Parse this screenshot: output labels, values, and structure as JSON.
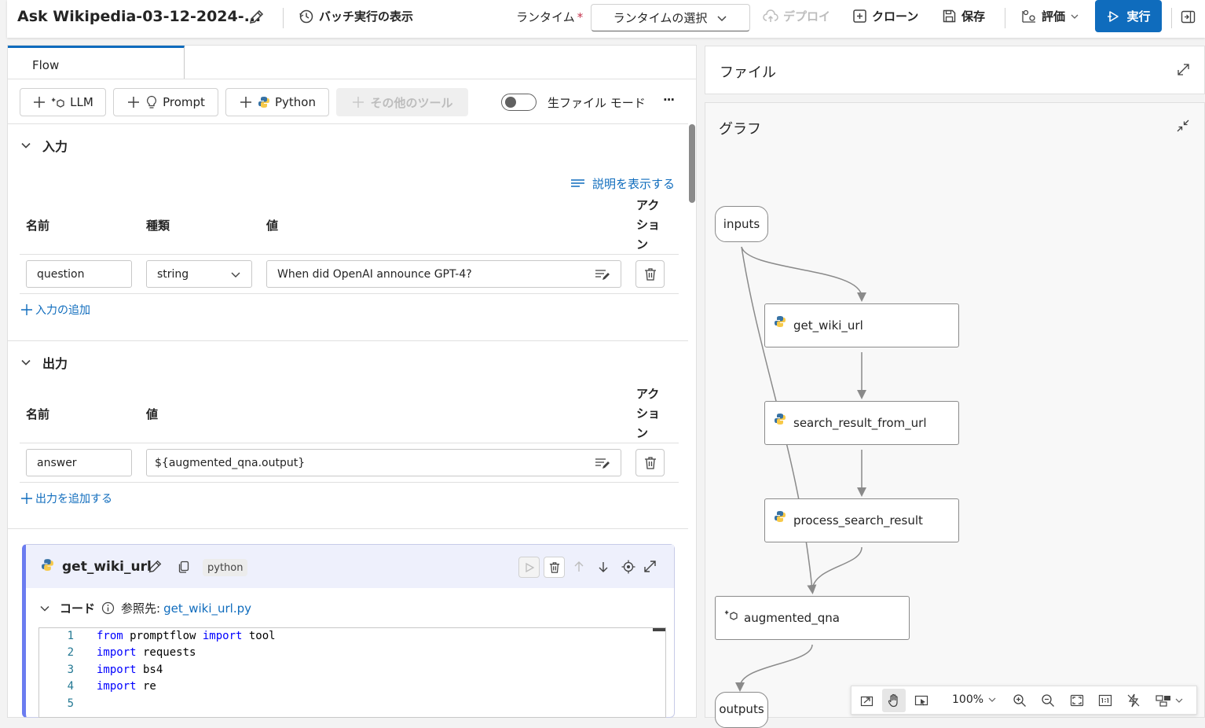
{
  "header": {
    "flow_title": "Ask Wikipedia-03-12-2024-...",
    "batch_view": "バッチ実行の表示",
    "runtime_label": "ランタイム",
    "runtime_required": "*",
    "runtime_select": "ランタイムの選択",
    "deploy": "デプロイ",
    "clone": "クローン",
    "save": "保存",
    "evaluate": "評価",
    "run": "実行"
  },
  "tabs": {
    "flow": "Flow"
  },
  "toolbar": {
    "llm": "LLM",
    "prompt": "Prompt",
    "python": "Python",
    "more_tools": "その他のツール",
    "raw_file_mode": "生ファイル モード",
    "more": "···"
  },
  "inputs": {
    "title": "入力",
    "show_description": "説明を表示する",
    "col_name": "名前",
    "col_type": "種類",
    "col_value": "値",
    "col_action_lines": [
      "アク",
      "ショ",
      "ン"
    ],
    "rows": [
      {
        "name": "question",
        "type": "string",
        "value": "When did OpenAI announce GPT-4?"
      }
    ],
    "add": "入力の追加"
  },
  "outputs": {
    "title": "出力",
    "col_name": "名前",
    "col_value": "値",
    "col_action_lines": [
      "アク",
      "ショ",
      "ン"
    ],
    "rows": [
      {
        "name": "answer",
        "value": "${augmented_qna.output}"
      }
    ],
    "add": "出力を追加する"
  },
  "node": {
    "title": "get_wiki_url",
    "language": "python",
    "code_label": "コード",
    "ref_label": "参照先:",
    "ref_file": "get_wiki_url.py",
    "code_lines": [
      {
        "n": "1",
        "kw": "from",
        "rest_a": " promptflow ",
        "kw2": "import",
        "rest_b": " tool"
      },
      {
        "n": "2",
        "kw": "import",
        "rest_a": " requests",
        "kw2": "",
        "rest_b": ""
      },
      {
        "n": "3",
        "kw": "import",
        "rest_a": " bs4",
        "kw2": "",
        "rest_b": ""
      },
      {
        "n": "4",
        "kw": "import",
        "rest_a": " re",
        "kw2": "",
        "rest_b": ""
      },
      {
        "n": "5",
        "kw": "",
        "rest_a": "",
        "kw2": "",
        "rest_b": ""
      }
    ]
  },
  "files_panel": {
    "title": "ファイル"
  },
  "graph": {
    "title": "グラフ",
    "nodes": {
      "inputs": "inputs",
      "get_wiki_url": "get_wiki_url",
      "search_result_from_url": "search_result_from_url",
      "process_search_result": "process_search_result",
      "augmented_qna": "augmented_qna",
      "outputs": "outputs"
    },
    "zoom": "100%"
  },
  "colors": {
    "accent": "#0f6cbd",
    "node_accent": "#6b7cf0",
    "python_blue": "#3772a4",
    "python_yellow": "#f7c948"
  }
}
